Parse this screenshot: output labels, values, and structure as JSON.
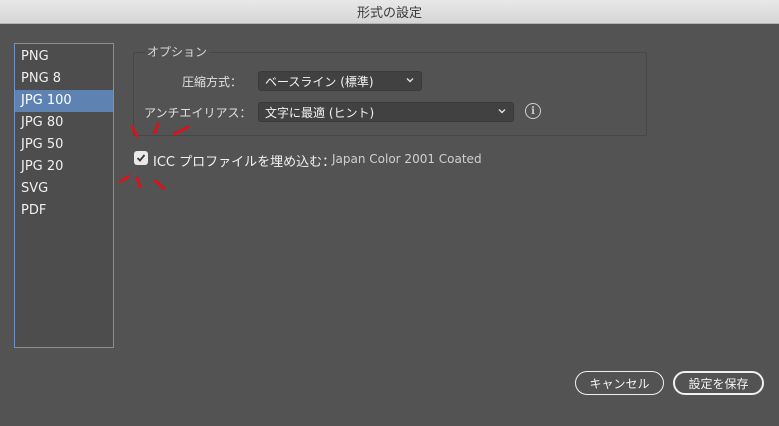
{
  "window": {
    "title": "形式の設定"
  },
  "formats": {
    "items": [
      "PNG",
      "PNG 8",
      "JPG 100",
      "JPG 80",
      "JPG 50",
      "JPG 20",
      "SVG",
      "PDF"
    ],
    "selected": "JPG 100"
  },
  "options": {
    "group_label": "オプション",
    "compression": {
      "label": "圧縮方式：",
      "value": "ベースライン (標準)"
    },
    "antialias": {
      "label": "アンチエイリアス：",
      "value": "文字に最適 (ヒント)"
    },
    "info_icon": "info-icon"
  },
  "icc": {
    "checked": true,
    "label": "ICC プロファイルを埋め込む：",
    "profile": "Japan Color 2001 Coated"
  },
  "buttons": {
    "cancel": "キャンセル",
    "save": "設定を保存"
  },
  "colors": {
    "selection": "#5e82b2",
    "annotation": "#d3151d",
    "background": "#535353"
  }
}
